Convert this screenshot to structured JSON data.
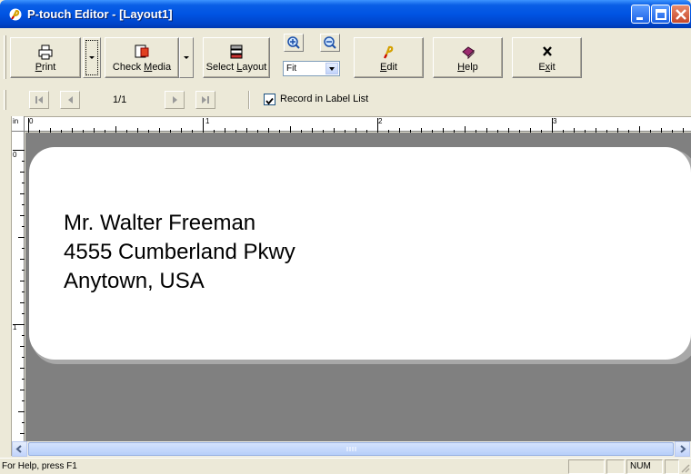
{
  "window": {
    "title": "P-touch Editor - [Layout1]"
  },
  "toolbar": {
    "print_label": "Print",
    "check_media_label": "Check Media",
    "select_layout_label": "Select Layout",
    "zoom_value": "Fit",
    "edit_label": "Edit",
    "help_label": "Help",
    "exit_label": "Exit"
  },
  "navigation": {
    "page_indicator": "1/1",
    "record_label": "Record in Label List",
    "record_checked": true
  },
  "ruler": {
    "unit": "in",
    "h_labels": [
      "0",
      "1",
      "2",
      "3"
    ],
    "v_labels": [
      "0",
      "1"
    ]
  },
  "label": {
    "lines": [
      "Mr. Walter Freeman",
      "4555 Cumberland Pkwy",
      "Anytown, USA"
    ]
  },
  "statusbar": {
    "help_text": "For Help, press F1",
    "num_indicator": "NUM"
  },
  "colors": {
    "titlebar": "#0054e3",
    "canvas": "#808080",
    "paper": "#ffffff"
  }
}
